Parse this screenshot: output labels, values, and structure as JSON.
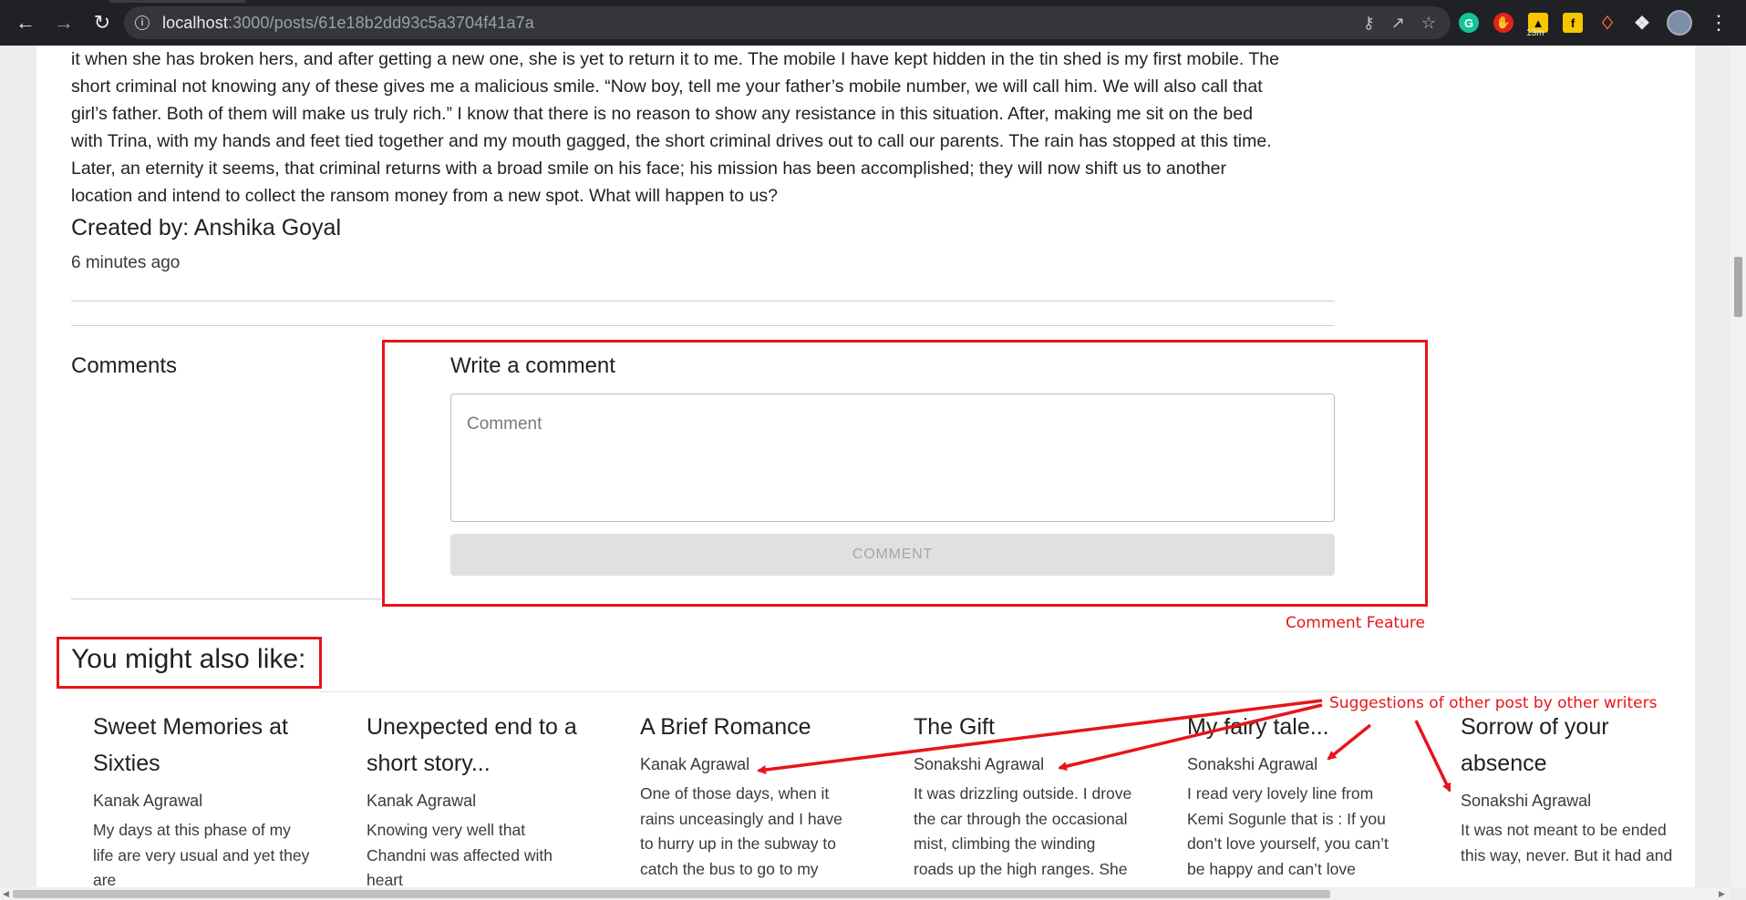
{
  "browser": {
    "url_host": "localhost",
    "url_path": ":3000/posts/61e18b2dd93c5a3704f41a7a",
    "ext_badge": "13m",
    "icons": [
      "back-icon",
      "forward-icon",
      "reload-icon",
      "info-icon",
      "key-icon",
      "share-icon",
      "star-icon",
      "grammarly-icon",
      "adblock-icon",
      "timer-extension-icon",
      "flipkart-icon",
      "tag-icon",
      "extensions-icon",
      "profile-avatar",
      "menu-icon"
    ]
  },
  "article": {
    "lines": [
      "it when she has broken hers, and after getting a new one, she is yet to return it to me. The mobile I have kept hidden in the tin shed is my first mobile. The",
      "short criminal not knowing any of these gives me a malicious smile. “Now boy, tell me your father’s mobile number, we will call him. We will also call that",
      "girl’s father. Both of them will make us truly rich.” I know that there is no reason to show any resistance in this situation. After, making me sit on the bed",
      "with Trina, with my hands and feet tied together and my mouth gagged, the short criminal drives out to call our parents. The rain has stopped at this time.",
      "Later, an eternity it seems, that criminal returns with a broad smile on his face; his mission has been accomplished; they will now shift us to another",
      "location and intend to collect the ransom money from a new spot. What will happen to us?"
    ],
    "created_by": "Created by: Anshika Goyal",
    "time_ago": "6 minutes ago"
  },
  "comments": {
    "label": "Comments",
    "write_title": "Write a comment",
    "placeholder": "Comment",
    "button_label": "COMMENT"
  },
  "annotations": {
    "comment_feature": "Comment Feature",
    "suggestions": "Suggestions of other post by other writers",
    "color": "#e8141a"
  },
  "suggestions": {
    "heading": "You might also like:",
    "cards": [
      {
        "title": "Sweet Memories at Sixties",
        "author": "Kanak Agrawal",
        "excerpt": "My days at this phase of my life are very usual and yet they are"
      },
      {
        "title": "Unexpected end to a short story...",
        "author": "Kanak Agrawal",
        "excerpt": "Knowing very well that Chandni was affected with heart"
      },
      {
        "title": "A Brief Romance",
        "author": "Kanak Agrawal",
        "excerpt": "One of those days, when it rains unceasingly and I have to hurry up in the subway to catch the bus to go to my workplace."
      },
      {
        "title": "The Gift",
        "author": "Sonakshi Agrawal",
        "excerpt": "It was drizzling outside. I drove the car through the occasional mist, climbing the winding roads up the high ranges. She"
      },
      {
        "title": "My fairy tale...",
        "author": "Sonakshi Agrawal",
        "excerpt": "I read very lovely line from Kemi Sogunle that is : If you don’t love yourself, you can’t be happy and can’t love anyone"
      },
      {
        "title": "Sorrow of your absence",
        "author": "Sonakshi Agrawal",
        "excerpt": "It was not meant to be ended this way, never. But it had and"
      }
    ]
  }
}
